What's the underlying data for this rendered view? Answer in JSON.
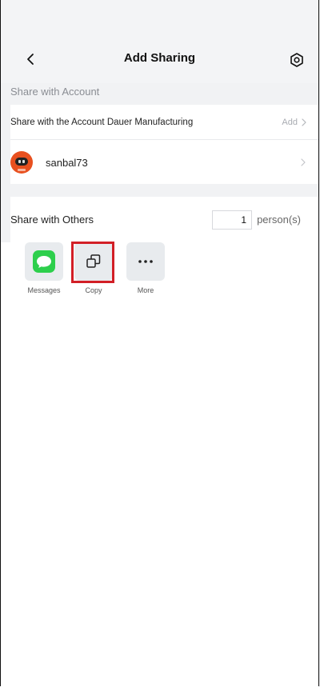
{
  "header": {
    "title": "Add Sharing",
    "back_icon": "chevron-left-icon",
    "settings_icon": "hexagon-settings-icon"
  },
  "account_section": {
    "label": "Share with Account",
    "share_row_label": "Share with the Account Dauer Manufacturing",
    "add_label": "Add",
    "user": {
      "name": "sanbal73",
      "avatar_color": "#e8501f"
    }
  },
  "others_section": {
    "label": "Share with Others",
    "count": "1",
    "unit": "person(s)"
  },
  "share_options": [
    {
      "label": "Messages",
      "icon": "messages-icon",
      "color": "#2dcf4c"
    },
    {
      "label": "Copy",
      "icon": "copy-icon",
      "highlight_color": "#d21f26"
    },
    {
      "label": "More",
      "icon": "more-icon"
    }
  ]
}
